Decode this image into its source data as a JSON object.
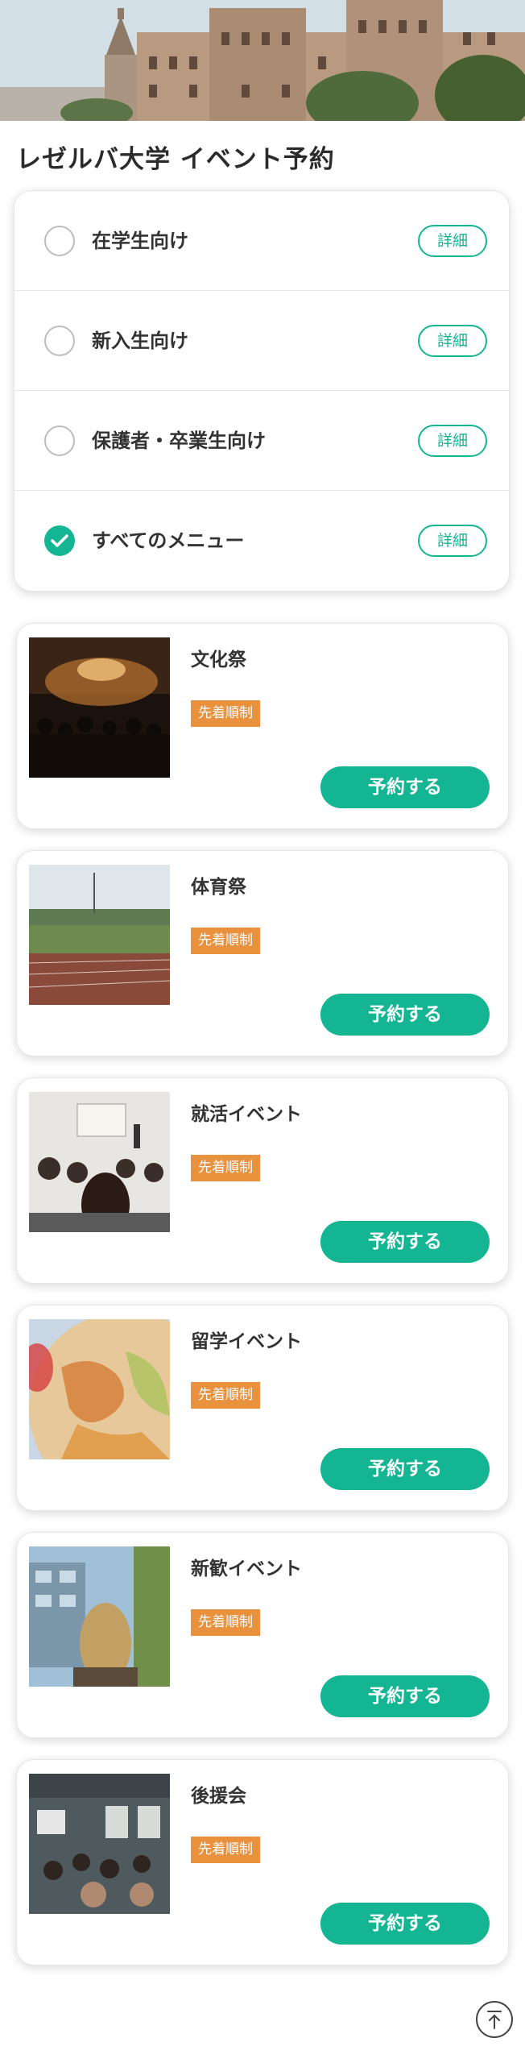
{
  "page": {
    "title": "レゼルバ大学 イベント予約"
  },
  "menu": {
    "items": [
      {
        "label": "在学生向け",
        "checked": false,
        "detail_label": "詳細"
      },
      {
        "label": "新入生向け",
        "checked": false,
        "detail_label": "詳細"
      },
      {
        "label": "保護者・卒業生向け",
        "checked": false,
        "detail_label": "詳細"
      },
      {
        "label": "すべてのメニュー",
        "checked": true,
        "detail_label": "詳細"
      }
    ]
  },
  "events": [
    {
      "title": "文化祭",
      "badge": "先着順制",
      "button": "予約する"
    },
    {
      "title": "体育祭",
      "badge": "先着順制",
      "button": "予約する"
    },
    {
      "title": "就活イベント",
      "badge": "先着順制",
      "button": "予約する"
    },
    {
      "title": "留学イベント",
      "badge": "先着順制",
      "button": "予約する"
    },
    {
      "title": "新歓イベント",
      "badge": "先着順制",
      "button": "予約する"
    },
    {
      "title": "後援会",
      "badge": "先着順制",
      "button": "予約する"
    }
  ],
  "colors": {
    "accent": "#14b592",
    "badge": "#e9913c"
  },
  "icons": {
    "scroll_top": "arrow-up-circle-icon",
    "checked": "checkmark-icon"
  }
}
